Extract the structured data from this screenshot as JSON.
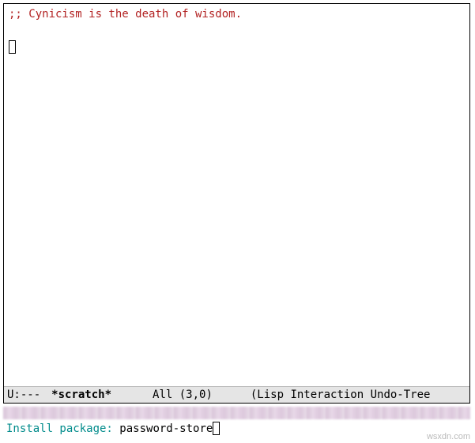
{
  "buffer": {
    "comment": ";; Cynicism is the death of wisdom."
  },
  "modeline": {
    "status": "U:---",
    "buffer_name": "*scratch*",
    "position": "All (3,0)",
    "modes": "(Lisp Interaction Undo-Tree"
  },
  "minibuffer": {
    "prompt": "Install package: ",
    "input": "password-store"
  },
  "watermark": "wsxdn.com"
}
